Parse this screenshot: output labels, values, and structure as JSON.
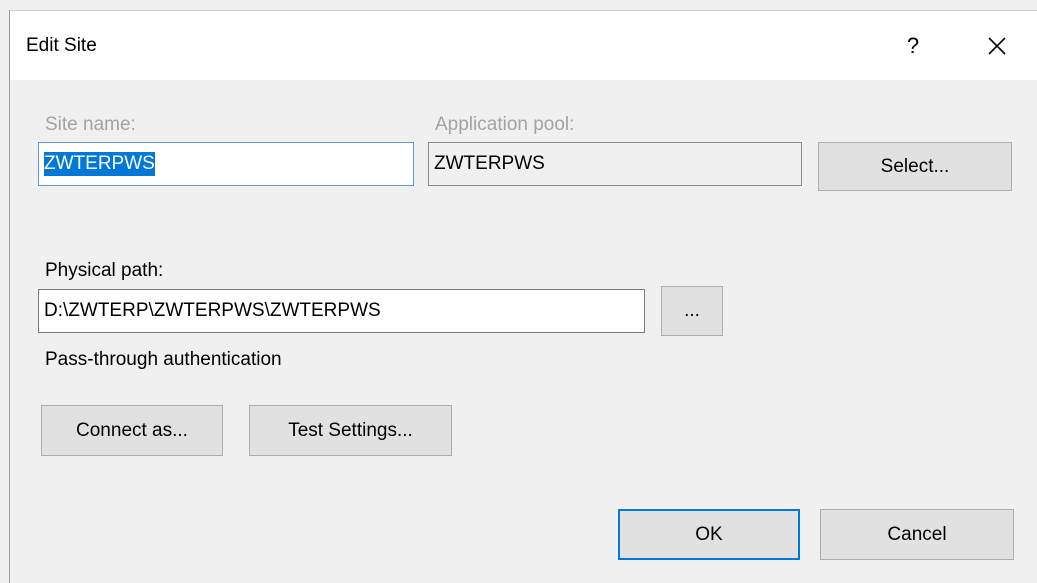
{
  "window": {
    "title": "Edit Site",
    "help_label": "?",
    "close_icon": "close-icon"
  },
  "site": {
    "name_label": "Site name:",
    "name_value": "ZWTERPWS",
    "pool_label": "Application pool:",
    "pool_value": "ZWTERPWS",
    "select_label": "Select..."
  },
  "path": {
    "label": "Physical path:",
    "value": "D:\\ZWTERP\\ZWTERPWS\\ZWTERPWS",
    "browse_label": "..."
  },
  "auth": {
    "label": "Pass-through authentication",
    "connect_label": "Connect as...",
    "test_label": "Test Settings..."
  },
  "actions": {
    "ok_label": "OK",
    "cancel_label": "Cancel"
  },
  "colors": {
    "selection": "#0078d7",
    "focus_border": "#0078d7",
    "disabled_text": "#a3a3a3"
  }
}
